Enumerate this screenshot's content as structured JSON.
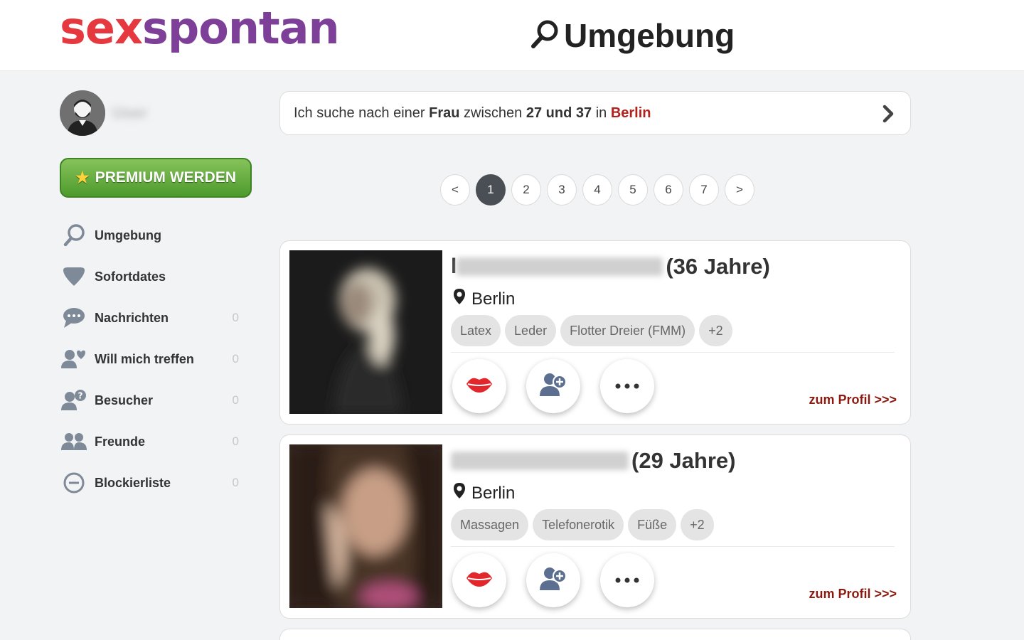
{
  "header": {
    "logo_part1": "sex",
    "logo_part2": "spontan",
    "page_title": "Umgebung"
  },
  "sidebar": {
    "username": "User",
    "premium_label": "PREMIUM WERDEN",
    "items": [
      {
        "label": "Umgebung",
        "count": "",
        "icon": "search-icon"
      },
      {
        "label": "Sofortdates",
        "count": "",
        "icon": "heart-icon"
      },
      {
        "label": "Nachrichten",
        "count": "0",
        "icon": "chat-icon"
      },
      {
        "label": "Will mich treffen",
        "count": "0",
        "icon": "user-heart-icon"
      },
      {
        "label": "Besucher",
        "count": "0",
        "icon": "user-question-icon"
      },
      {
        "label": "Freunde",
        "count": "0",
        "icon": "friends-icon"
      },
      {
        "label": "Blockierliste",
        "count": "0",
        "icon": "block-icon"
      }
    ]
  },
  "search": {
    "prefix": "Ich suche nach einer",
    "gender": "Frau",
    "between": "zwischen",
    "age_range": "27 und 37",
    "in": "in",
    "city": "Berlin"
  },
  "pagination": {
    "prev": "<",
    "pages": [
      "1",
      "2",
      "3",
      "4",
      "5",
      "6",
      "7"
    ],
    "active": "1",
    "next": ">"
  },
  "profiles": [
    {
      "name_prefix": "l",
      "age": "(36 Jahre)",
      "location": "Berlin",
      "tags": [
        "Latex",
        "Leder",
        "Flotter Dreier (FMM)",
        "+2"
      ],
      "profile_link": "zum Profil >>>"
    },
    {
      "name_prefix": "",
      "age": "(29 Jahre)",
      "location": "Berlin",
      "tags": [
        "Massagen",
        "Telefonerotik",
        "Füße",
        "+2"
      ],
      "profile_link": "zum Profil >>>"
    }
  ],
  "colors": {
    "logo_red": "#e6393f",
    "logo_purple": "#7d3f98",
    "accent_red": "#b2211c",
    "premium_green": "#5aa836"
  }
}
